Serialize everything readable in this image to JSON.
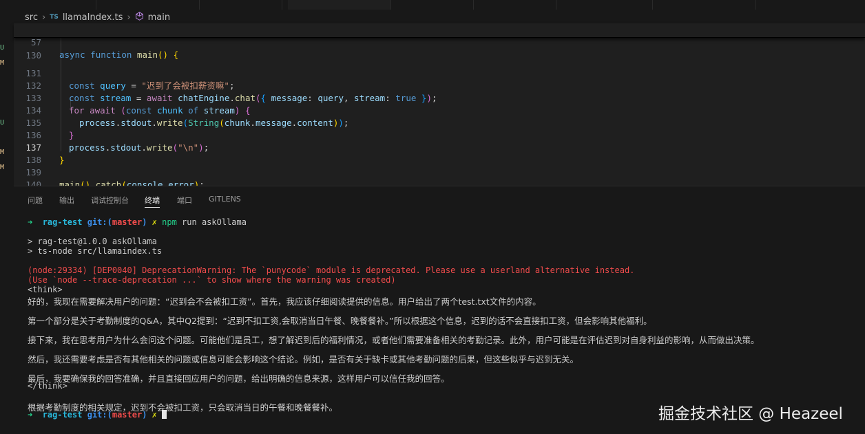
{
  "breadcrumb": {
    "folder": "src",
    "file_badge": "TS",
    "file": "llamaIndex.ts",
    "symbol": "main"
  },
  "gutter_markers": [
    "U",
    "M",
    "U",
    "M",
    "M"
  ],
  "editor": {
    "sticky": {
      "line": "57",
      "code": "async function main() {"
    },
    "lines": [
      {
        "n": "130",
        "text": ""
      },
      {
        "n": "131",
        "text": "const query = \"迟到了会被扣薪资嘛\";"
      },
      {
        "n": "132",
        "text": "const stream = await chatEngine.chat({ message: query, stream: true });"
      },
      {
        "n": "133",
        "text": "for await (const chunk of stream) {"
      },
      {
        "n": "134",
        "text": "process.stdout.write(String(chunk.message.content));"
      },
      {
        "n": "135",
        "text": "}"
      },
      {
        "n": "136",
        "text": "process.stdout.write(\"\\n\");"
      },
      {
        "n": "137",
        "text": "}"
      },
      {
        "n": "138",
        "text": ""
      },
      {
        "n": "139",
        "text": "main().catch(console.error);"
      },
      {
        "n": "140",
        "text": ""
      }
    ]
  },
  "panel": {
    "tabs": [
      "问题",
      "输出",
      "调试控制台",
      "终端",
      "端口",
      "GITLENS"
    ],
    "active_tab": "终端"
  },
  "terminal": {
    "prompt_arrow": "➜",
    "dir": "rag-test",
    "git_label": "git:(",
    "branch": "master",
    "git_close": ")",
    "dirty": "✗",
    "command": "npm run askOllama",
    "script_line1": "> rag-test@1.0.0 askOllama",
    "script_line2": "> ts-node src/llamaindex.ts",
    "warning1": "(node:29334) [DEP0040] DeprecationWarning: The `punycode` module is deprecated. Please use a userland alternative instead.",
    "warning2": "(Use `node --trace-deprecation ...` to show where the warning was created)",
    "think_open": "<think>",
    "para1": "好的，我现在需要解决用户的问题：“迟到会不会被扣工资”。首先，我应该仔细阅读提供的信息。用户给出了两个test.txt文件的内容。",
    "para2": "第一个部分是关于考勤制度的Q&A，其中Q2提到：“迟到不扣工资,会取消当日午餐、晚餐餐补。”所以根据这个信息，迟到的话不会直接扣工资，但会影响其他福利。",
    "para3": "接下来，我在思考用户为什么会问这个问题。可能他们是员工，想了解迟到后的福利情况，或者他们需要准备相关的考勤记录。此外，用户可能是在评估迟到对自身利益的影响，从而做出决策。",
    "para4": "然后，我还需要考虑是否有其他相关的问题或信息可能会影响这个结论。例如，是否有关于缺卡或其他考勤问题的后果，但这些似乎与迟到无关。",
    "para5": "最后，我要确保我的回答准确，并且直接回应用户的问题，给出明确的信息来源，这样用户可以信任我的回答。",
    "think_close": "</think>",
    "answer": "根据考勤制度的相关规定，迟到不会被扣工资，只会取消当日的午餐和晚餐餐补。"
  },
  "watermark": "掘金技术社区 @ Heazeel"
}
